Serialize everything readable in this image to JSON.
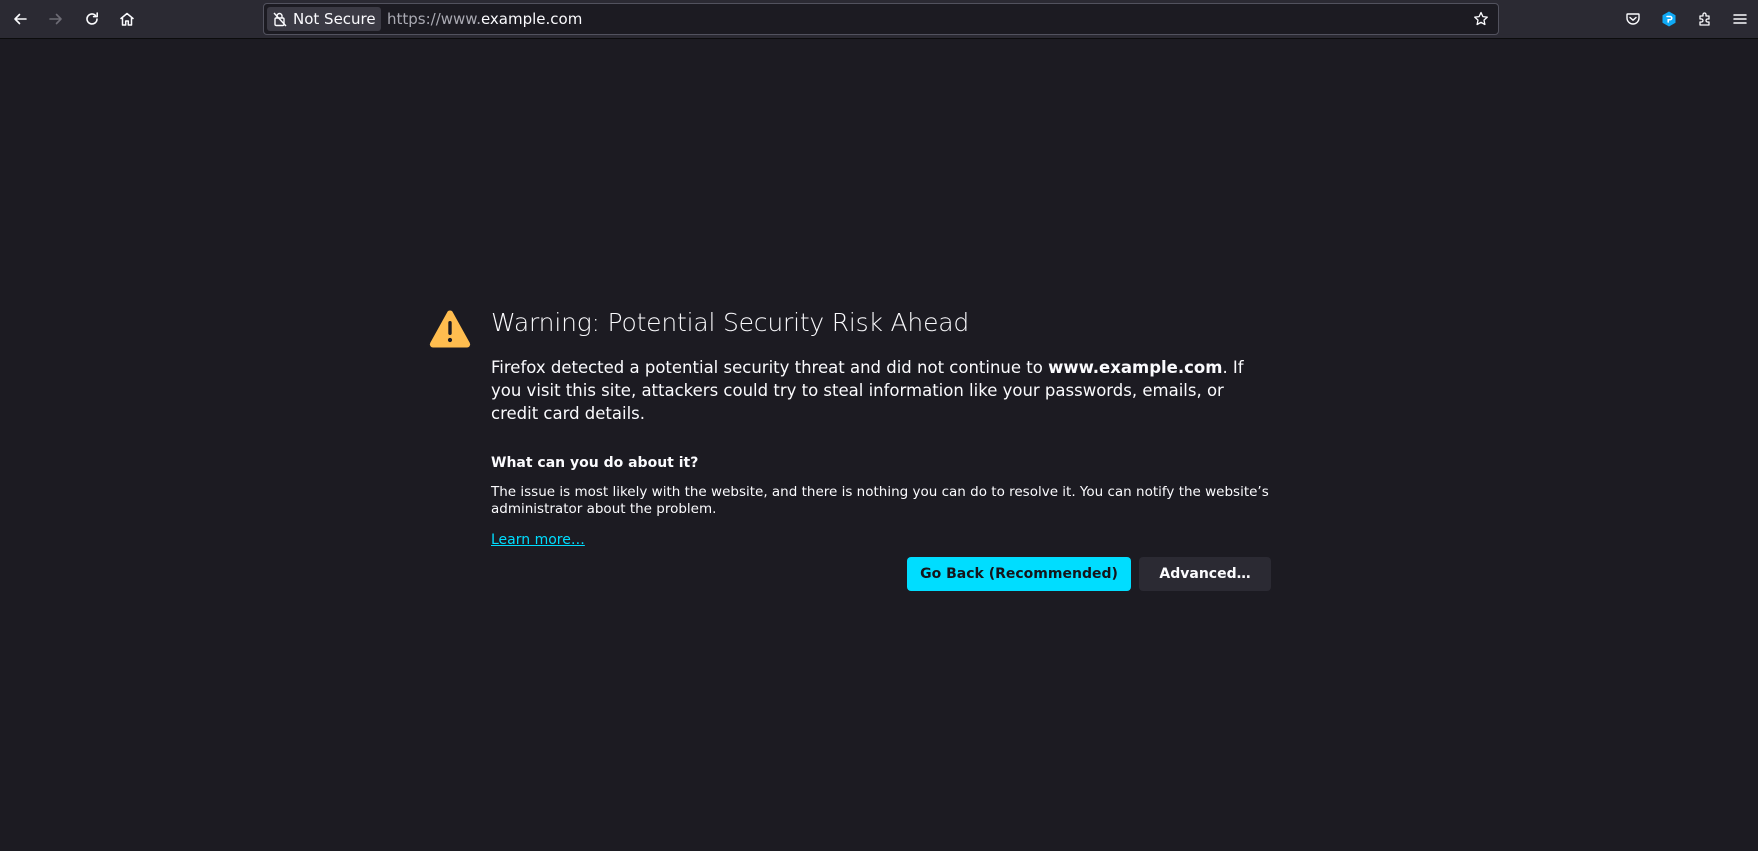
{
  "toolbar": {
    "back_icon": "arrow-left-icon",
    "forward_icon": "arrow-right-icon",
    "reload_icon": "reload-icon",
    "home_icon": "home-icon",
    "identity_label": "Not Secure",
    "url_prefix": "https://www.",
    "url_domain": "example.com",
    "bookmark_icon": "star-icon",
    "pocket_icon": "pocket-icon",
    "extension_icon": "extension-badge-icon",
    "extensions_icon": "puzzle-icon",
    "menu_icon": "hamburger-menu-icon"
  },
  "error_page": {
    "title": "Warning: Potential Security Risk Ahead",
    "intro_before": "Firefox detected a potential security threat and did not continue to ",
    "intro_host": "www.example.com",
    "intro_after": ". If you visit this site, attackers could try to steal information like your passwords, emails, or credit card details.",
    "subheading": "What can you do about it?",
    "detail": "The issue is most likely with the website, and there is nothing you can do to resolve it. You can notify the website’s administrator about the problem.",
    "learn_more": "Learn more…",
    "go_back_label": "Go Back (Recommended)",
    "advanced_label": "Advanced…"
  },
  "colors": {
    "page_background": "#1c1b22",
    "toolbar_background": "#2b2a33",
    "accent": "#00ddff",
    "warning_icon": "#ffbd4f"
  }
}
